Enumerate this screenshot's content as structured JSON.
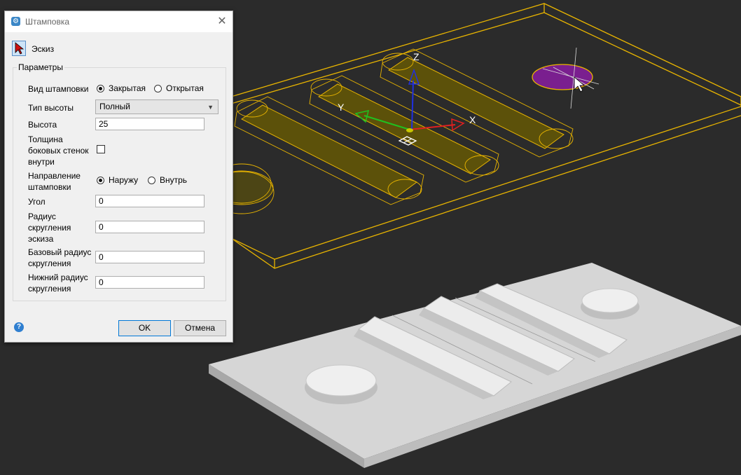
{
  "dialog": {
    "title": "Штамповка",
    "close_glyph": "✕",
    "sketch_label": "Эскиз",
    "group_title": "Параметры",
    "stamp_type": {
      "label": "Вид штамповки",
      "option_closed": "Закрытая",
      "option_open": "Открытая",
      "selected": "Закрытая"
    },
    "height_type": {
      "label": "Тип высоты",
      "value": "Полный"
    },
    "height": {
      "label": "Высота",
      "value": "25"
    },
    "wall_thickness": {
      "label_line1": "Толщина",
      "label_line2": "боковых стенок",
      "label_line3": "внутри",
      "checked": false
    },
    "direction": {
      "label_line1": "Направление",
      "label_line2": "штамповки",
      "option_out": "Наружу",
      "option_in": "Внутрь",
      "selected": "Наружу"
    },
    "angle": {
      "label": "Угол",
      "value": "0"
    },
    "sketch_radius": {
      "label_line1": "Радиус",
      "label_line2": "скругления",
      "label_line3": "эскиза",
      "value": "0"
    },
    "base_radius": {
      "label_line1": "Базовый радиус",
      "label_line2": "скругления",
      "value": "0"
    },
    "bottom_radius": {
      "label_line1": "Нижний радиус",
      "label_line2": "скругления",
      "value": "0"
    },
    "help_glyph": "?",
    "ok_label": "OK",
    "cancel_label": "Отмена"
  },
  "viewport": {
    "axis_x": "X",
    "axis_y": "Y",
    "axis_z": "Z",
    "colors": {
      "background": "#2b2b2b",
      "wireframe": "#e8b400",
      "highlight_fill": "#8a7a00",
      "selection": "#7a1f8f",
      "solid": "#d9d9d9",
      "axis_x": "#e02020",
      "axis_y": "#20c020",
      "axis_z": "#2030e0"
    }
  }
}
